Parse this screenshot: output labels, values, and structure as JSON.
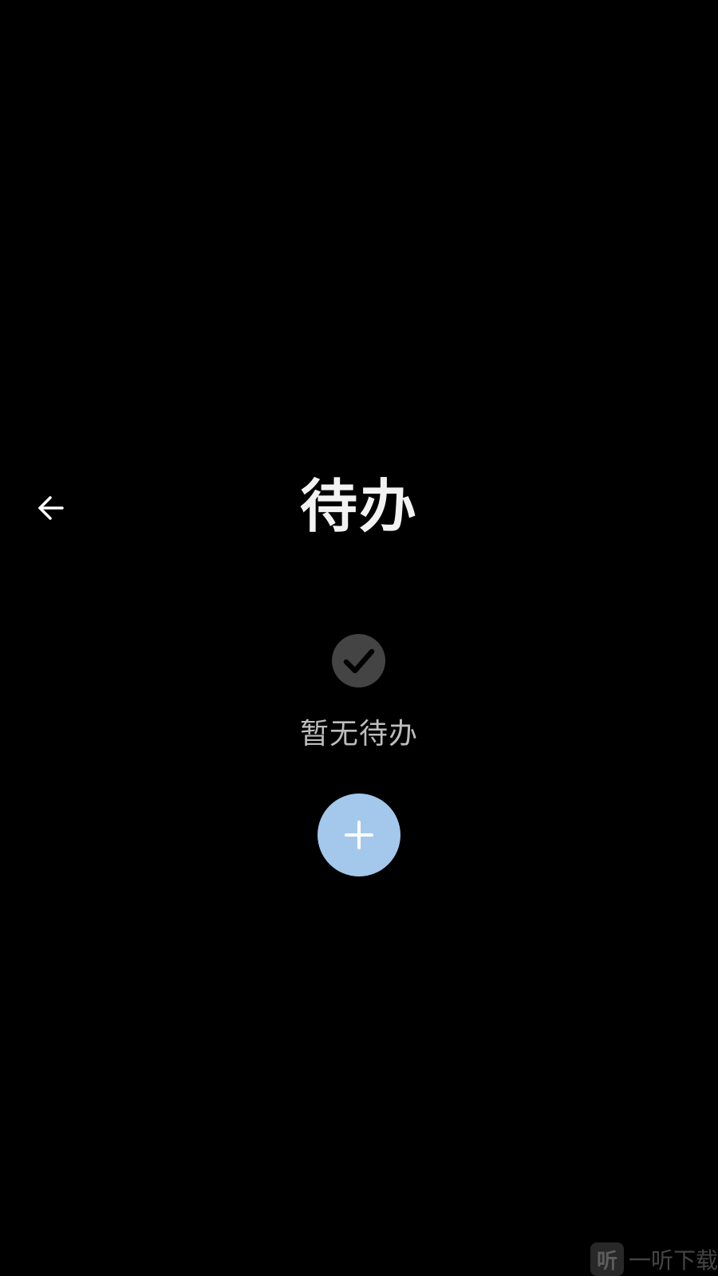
{
  "header": {
    "title": "待办",
    "back_icon": "arrow-left-icon"
  },
  "empty_state": {
    "icon": "check-circle-icon",
    "message": "暂无待办"
  },
  "fab": {
    "icon": "plus-icon",
    "color": "#a3c8ec"
  },
  "watermark": {
    "logo_char": "听",
    "text": "一听下载"
  },
  "colors": {
    "background": "#000000",
    "title": "#f2f2f2",
    "empty_text": "#bdbdbd",
    "empty_icon_bg": "#444444"
  }
}
